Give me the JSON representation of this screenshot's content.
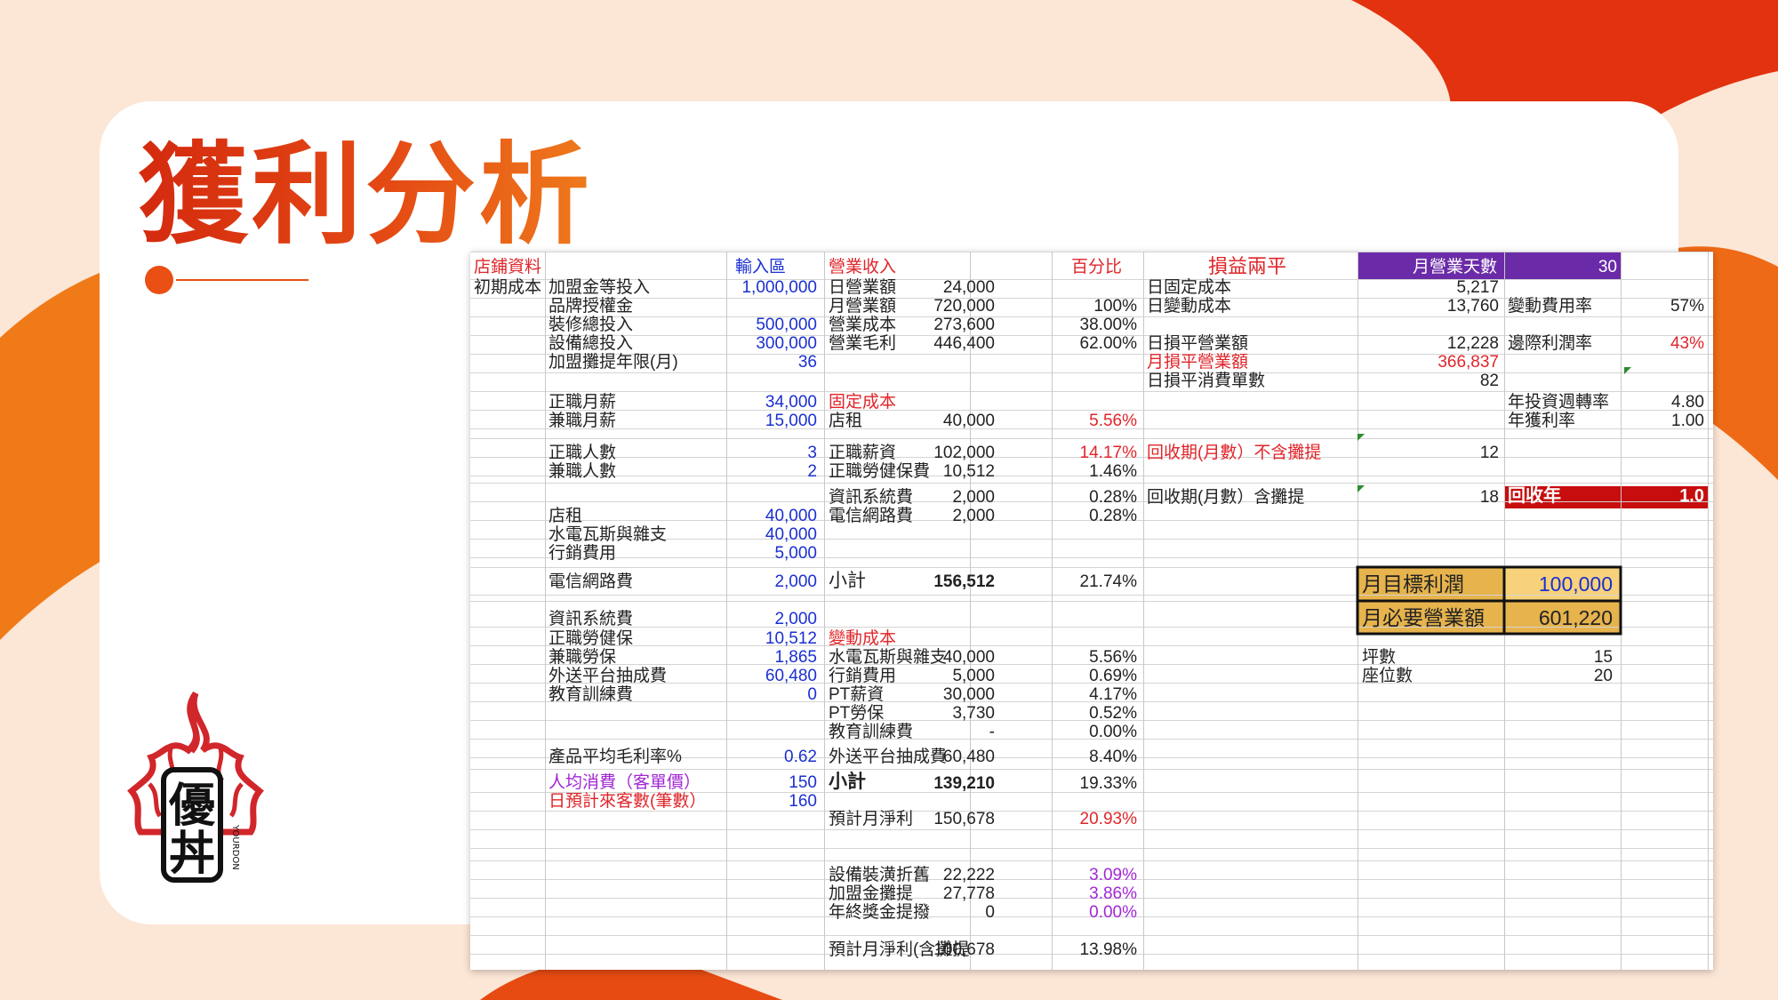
{
  "slide": {
    "title": "獲利分析"
  },
  "logo": {
    "char1": "優",
    "char2": "丼",
    "brand": "YOURDON"
  },
  "colors": {
    "brand": "#e0391a",
    "input_blue": "#1a2fd0",
    "alert_red": "#e0252a",
    "purple_header": "#6b2ba8",
    "dark_red": "#c70d0d",
    "gold": "#e6b34c"
  },
  "sheet": {
    "headers": {
      "store_info": "店鋪資料",
      "input_area": "輸入區",
      "revenue": "營業收入",
      "percent": "百分比",
      "breakeven": "損益兩平",
      "month_days_label": "月營業天數",
      "month_days_value": "30"
    },
    "store": {
      "initial_cost": "初期成本",
      "franchise_fee": {
        "label": "加盟金等投入",
        "value": "1,000,000"
      },
      "brand_license": {
        "label": "品牌授權金",
        "value": ""
      },
      "renovation": {
        "label": "裝修總投入",
        "value": "500,000"
      },
      "equipment": {
        "label": "設備總投入",
        "value": "300,000"
      },
      "amort_months": {
        "label": "加盟攤提年限(月)",
        "value": "36"
      },
      "ft_salary": {
        "label": "正職月薪",
        "value": "34,000"
      },
      "pt_salary": {
        "label": "兼職月薪",
        "value": "15,000"
      },
      "ft_count": {
        "label": "正職人數",
        "value": "3"
      },
      "pt_count": {
        "label": "兼職人數",
        "value": "2"
      },
      "rent": {
        "label": "店租",
        "value": "40,000"
      },
      "utilities": {
        "label": "水電瓦斯與雜支",
        "value": "40,000"
      },
      "marketing": {
        "label": "行銷費用",
        "value": "5,000"
      },
      "telecom": {
        "label": "電信網路費",
        "value": "2,000"
      },
      "it_system": {
        "label": "資訊系統費",
        "value": "2,000"
      },
      "ft_insurance": {
        "label": "正職勞健保",
        "value": "10,512"
      },
      "pt_insurance": {
        "label": "兼職勞保",
        "value": "1,865"
      },
      "delivery": {
        "label": "外送平台抽成費",
        "value": "60,480"
      },
      "training": {
        "label": "教育訓練費",
        "value": "0"
      },
      "gross_margin": {
        "label": "產品平均毛利率%",
        "value": "0.62"
      },
      "avg_ticket": {
        "label": "人均消費（客單價）",
        "value": "150"
      },
      "daily_customers": {
        "label": "日預計來客數(筆數）",
        "value": "160"
      }
    },
    "revenue": {
      "daily": {
        "label": "日營業額",
        "value": "24,000",
        "pct": ""
      },
      "monthly": {
        "label": "月營業額",
        "value": "720,000",
        "pct": "100%"
      },
      "cogs": {
        "label": "營業成本",
        "value": "273,600",
        "pct": "38.00%"
      },
      "gross": {
        "label": "營業毛利",
        "value": "446,400",
        "pct": "62.00%"
      },
      "fixed_header": "固定成本",
      "rent": {
        "label": "店租",
        "value": "40,000",
        "pct": "5.56%"
      },
      "ft_salary": {
        "label": "正職薪資",
        "value": "102,000",
        "pct": "14.17%"
      },
      "ft_insurance": {
        "label": "正職勞健保費",
        "value": "10,512",
        "pct": "1.46%"
      },
      "it_system": {
        "label": "資訊系統費",
        "value": "2,000",
        "pct": "0.28%"
      },
      "telecom": {
        "label": "電信網路費",
        "value": "2,000",
        "pct": "0.28%"
      },
      "fixed_subtotal": {
        "label": "小計",
        "value": "156,512",
        "pct": "21.74%"
      },
      "var_header": "變動成本",
      "utilities": {
        "label": "水電瓦斯與雜支",
        "value": "40,000",
        "pct": "5.56%"
      },
      "marketing": {
        "label": "行銷費用",
        "value": "5,000",
        "pct": "0.69%"
      },
      "pt_salary": {
        "label": "PT薪資",
        "value": "30,000",
        "pct": "4.17%"
      },
      "pt_insurance": {
        "label": "PT勞保",
        "value": "3,730",
        "pct": "0.52%"
      },
      "training": {
        "label": "教育訓練費",
        "value": "-",
        "pct": "0.00%"
      },
      "delivery": {
        "label": "外送平台抽成費",
        "value": "60,480",
        "pct": "8.40%"
      },
      "var_subtotal": {
        "label": "小計",
        "value": "139,210",
        "pct": "19.33%"
      },
      "net": {
        "label": "預計月淨利",
        "value": "150,678",
        "pct": "20.93%"
      },
      "depreciation": {
        "label": "設備裝潢折舊",
        "value": "22,222",
        "pct": "3.09%"
      },
      "franchise_amort": {
        "label": "加盟金攤提",
        "value": "27,778",
        "pct": "3.86%"
      },
      "bonus": {
        "label": "年終獎金提撥",
        "value": "0",
        "pct": "0.00%"
      },
      "net_with_amort": {
        "label": "預計月淨利(含攤提",
        "value": "100,678",
        "pct": "13.98%"
      }
    },
    "breakeven": {
      "daily_fixed": {
        "label": "日固定成本",
        "value": "5,217"
      },
      "daily_variable": {
        "label": "日變動成本",
        "value": "13,760"
      },
      "var_rate": {
        "label": "變動費用率",
        "value": "57%"
      },
      "daily_be_sales": {
        "label": "日損平營業額",
        "value": "12,228"
      },
      "margin_rate": {
        "label": "邊際利潤率",
        "value": "43%"
      },
      "monthly_be_sales": {
        "label": "月損平營業額",
        "value": "366,837"
      },
      "daily_be_count": {
        "label": "日損平消費單數",
        "value": "82"
      },
      "turnover": {
        "label": "年投資週轉率",
        "value": "4.80"
      },
      "annual_profit_rate": {
        "label": "年獲利率",
        "value": "1.00"
      },
      "payback_excl": {
        "label": "回收期(月數）不含攤提",
        "value": "12"
      },
      "payback_incl": {
        "label": "回收期(月數）含攤提",
        "value": "18"
      },
      "payback_year": {
        "label": "回收年",
        "value": "1.0"
      },
      "target_profit": {
        "label": "月目標利潤",
        "value": "100,000"
      },
      "required_sales": {
        "label": "月必要營業額",
        "value": "601,220"
      },
      "ping": {
        "label": "坪數",
        "value": "15"
      },
      "seats": {
        "label": "座位數",
        "value": "20"
      }
    }
  }
}
